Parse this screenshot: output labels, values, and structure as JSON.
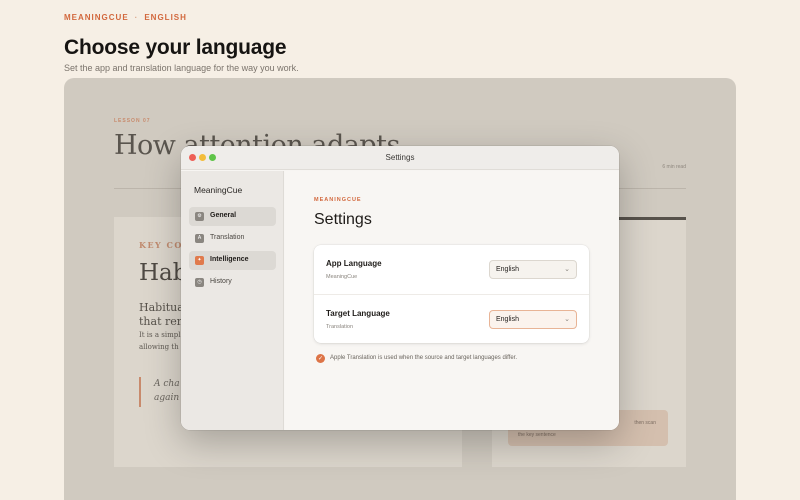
{
  "header": {
    "brand": "MEANINGCUE",
    "section": "ENGLISH",
    "title": "Choose your language",
    "subtitle": "Set the app and translation language for the way you work."
  },
  "background_article": {
    "eyebrow": "LESSON 07",
    "title": "How attention adapts",
    "read_time": "6 min read",
    "card": {
      "eyebrow": "KEY CO",
      "title": "Hab",
      "line1": "Habituat",
      "line2": "that rem",
      "line3": "It is a simpl",
      "line4": "allowing th",
      "quote1": "A cha",
      "quote2": "again"
    },
    "side_box": {
      "text": "the key sentence",
      "right": "then scan"
    }
  },
  "window": {
    "title": "Settings",
    "sidebar": {
      "app_name": "MeaningCue",
      "items": [
        {
          "label": "General",
          "icon": "gear-icon",
          "glyph": "⚙",
          "selected": true,
          "accent": false
        },
        {
          "label": "Translation",
          "icon": "translate-icon",
          "glyph": "A",
          "selected": false,
          "accent": false
        },
        {
          "label": "Intelligence",
          "icon": "sparkle-icon",
          "glyph": "✦",
          "selected": true,
          "accent": true
        },
        {
          "label": "History",
          "icon": "clock-icon",
          "glyph": "◷",
          "selected": false,
          "accent": false
        }
      ]
    },
    "content": {
      "eyebrow": "MEANINGCUE",
      "title": "Settings",
      "rows": [
        {
          "label": "App Language",
          "sublabel": "MeaningCue",
          "value": "English",
          "focused": false
        },
        {
          "label": "Target Language",
          "sublabel": "Translation",
          "value": "English",
          "focused": true
        }
      ],
      "note": "Apple Translation is used when the source and target languages differ."
    }
  },
  "colors": {
    "accent": "#d2683d",
    "page_bg": "#f6efe5",
    "dimmed_stage": "#d0cac0"
  }
}
